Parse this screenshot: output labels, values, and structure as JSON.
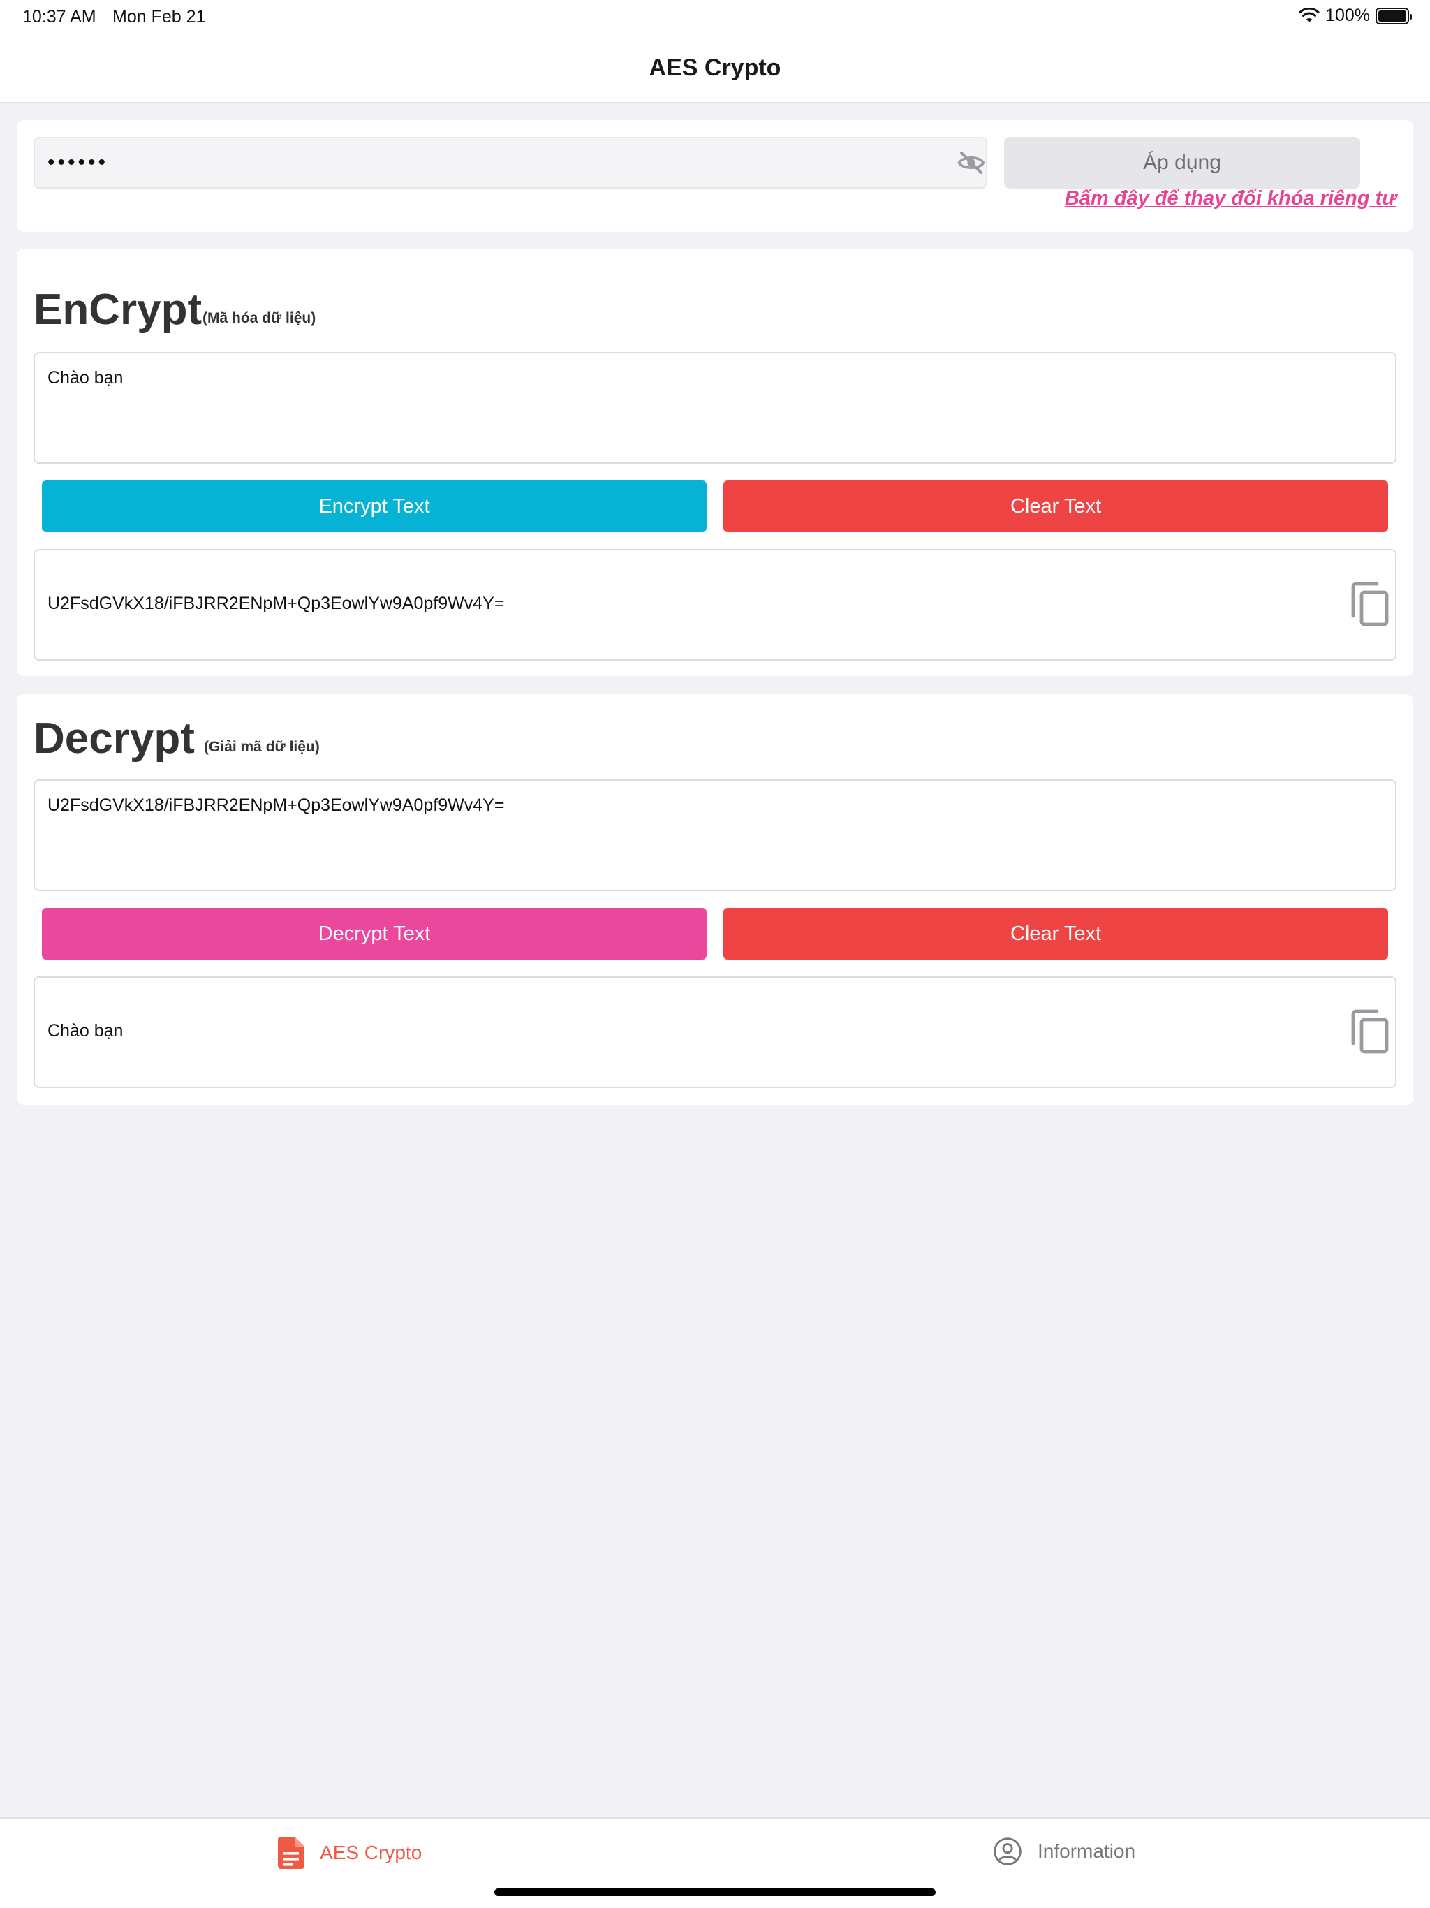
{
  "status_bar": {
    "time": "10:37 AM",
    "date": "Mon Feb 21",
    "battery": "100%",
    "wifi_icon": "wifi-icon",
    "battery_icon": "battery-full-icon"
  },
  "nav": {
    "title": "AES Crypto"
  },
  "key_section": {
    "masked_value": "••••••",
    "visibility_icon": "eye-off-icon",
    "apply_label": "Áp dụng",
    "change_key_link": "Bấm đây để thay đổi khóa riêng tư"
  },
  "encrypt": {
    "title": "EnCrypt",
    "subtitle": "(Mã hóa dữ liệu)",
    "input_value": "Chào bạn",
    "encrypt_label": "Encrypt Text",
    "clear_label": "Clear Text",
    "output_value": "U2FsdGVkX18/iFBJRR2ENpM+Qp3EowlYw9A0pf9Wv4Y=",
    "copy_icon": "copy-icon"
  },
  "decrypt": {
    "title": "Decrypt",
    "subtitle": "(Giải mã dữ liệu)",
    "input_value": "U2FsdGVkX18/iFBJRR2ENpM+Qp3EowlYw9A0pf9Wv4Y=",
    "decrypt_label": "Decrypt Text",
    "clear_label": "Clear Text",
    "output_value": "Chào bạn",
    "copy_icon": "copy-icon"
  },
  "tabs": [
    {
      "label": "AES Crypto",
      "icon": "document-icon",
      "active": true
    },
    {
      "label": "Information",
      "icon": "user-circle-icon",
      "active": false
    }
  ],
  "colors": {
    "encrypt_button": "#06b3d4",
    "decrypt_button": "#ea489c",
    "clear_button": "#ef4444",
    "link": "#e84394",
    "active_tab": "#ef5a45"
  }
}
